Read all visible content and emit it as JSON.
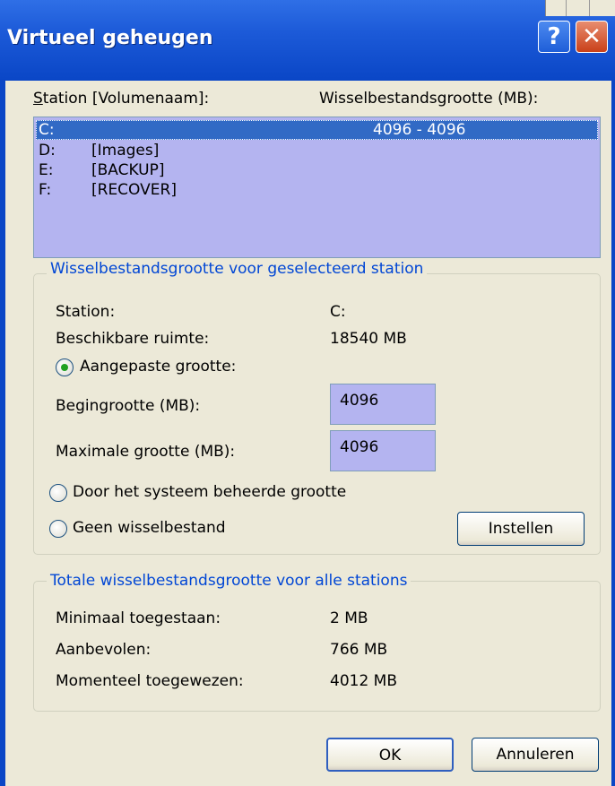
{
  "window": {
    "title": "Virtueel geheugen",
    "help_symbol": "?",
    "close_symbol": "✕"
  },
  "drive_list": {
    "header_station": "Station [Volumenaam]:",
    "header_size": "Wisselbestandsgrootte (MB):",
    "rows": [
      {
        "drive": "C:",
        "volume": "",
        "size": "4096 - 4096",
        "selected": true
      },
      {
        "drive": "D:",
        "volume": "[Images]",
        "size": ""
      },
      {
        "drive": "E:",
        "volume": "[BACKUP]",
        "size": ""
      },
      {
        "drive": "F:",
        "volume": "[RECOVER]",
        "size": ""
      }
    ]
  },
  "selected_group": {
    "title": "Wisselbestandsgrootte voor geselecteerd station",
    "station_label": "Station:",
    "station_value": "C:",
    "space_label": "Beschikbare ruimte:",
    "space_value": "18540 MB",
    "radio_custom": "Aangepaste grootte:",
    "initial_label": "Begingrootte (MB):",
    "initial_value": "4096",
    "max_label": "Maximale grootte (MB):",
    "max_value": "4096",
    "radio_system": "Door het systeem beheerde grootte",
    "radio_none": "Geen wisselbestand",
    "set_button": "Instellen"
  },
  "total_group": {
    "title": "Totale wisselbestandsgrootte voor alle stations",
    "min_label": "Minimaal toegestaan:",
    "min_value": "2 MB",
    "rec_label": "Aanbevolen:",
    "rec_value": "766 MB",
    "cur_label": "Momenteel toegewezen:",
    "cur_value": "4012 MB"
  },
  "buttons": {
    "ok": "OK",
    "cancel": "Annuleren"
  },
  "colors": {
    "titlebar": "#0a46c6",
    "dialog_bg": "#ece9d8",
    "group_title": "#0046d5",
    "list_bg": "#b4b4f0",
    "selection": "#316ac5"
  }
}
